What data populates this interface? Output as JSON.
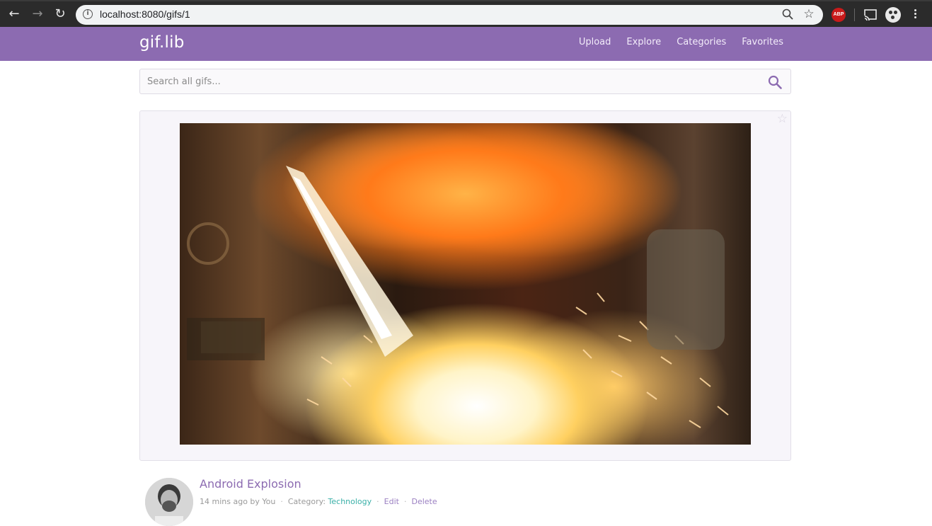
{
  "browser": {
    "url": "localhost:8080/gifs/1",
    "extension_badge": "ABP",
    "icons": [
      "back-icon",
      "forward-icon",
      "reload-icon",
      "info-icon",
      "zoom-icon",
      "bookmark-star-icon",
      "cast-icon",
      "profile-icon",
      "menu-icon"
    ]
  },
  "app": {
    "brand": "gif.lib",
    "nav": [
      "Upload",
      "Explore",
      "Categories",
      "Favorites"
    ],
    "accent_color": "#8c6bb1"
  },
  "search": {
    "placeholder": "Search all gifs..."
  },
  "gif": {
    "title": "Android Explosion",
    "posted": "14 mins ago by You",
    "category_label": "Category:",
    "category": "Technology",
    "edit_label": "Edit",
    "delete_label": "Delete"
  }
}
